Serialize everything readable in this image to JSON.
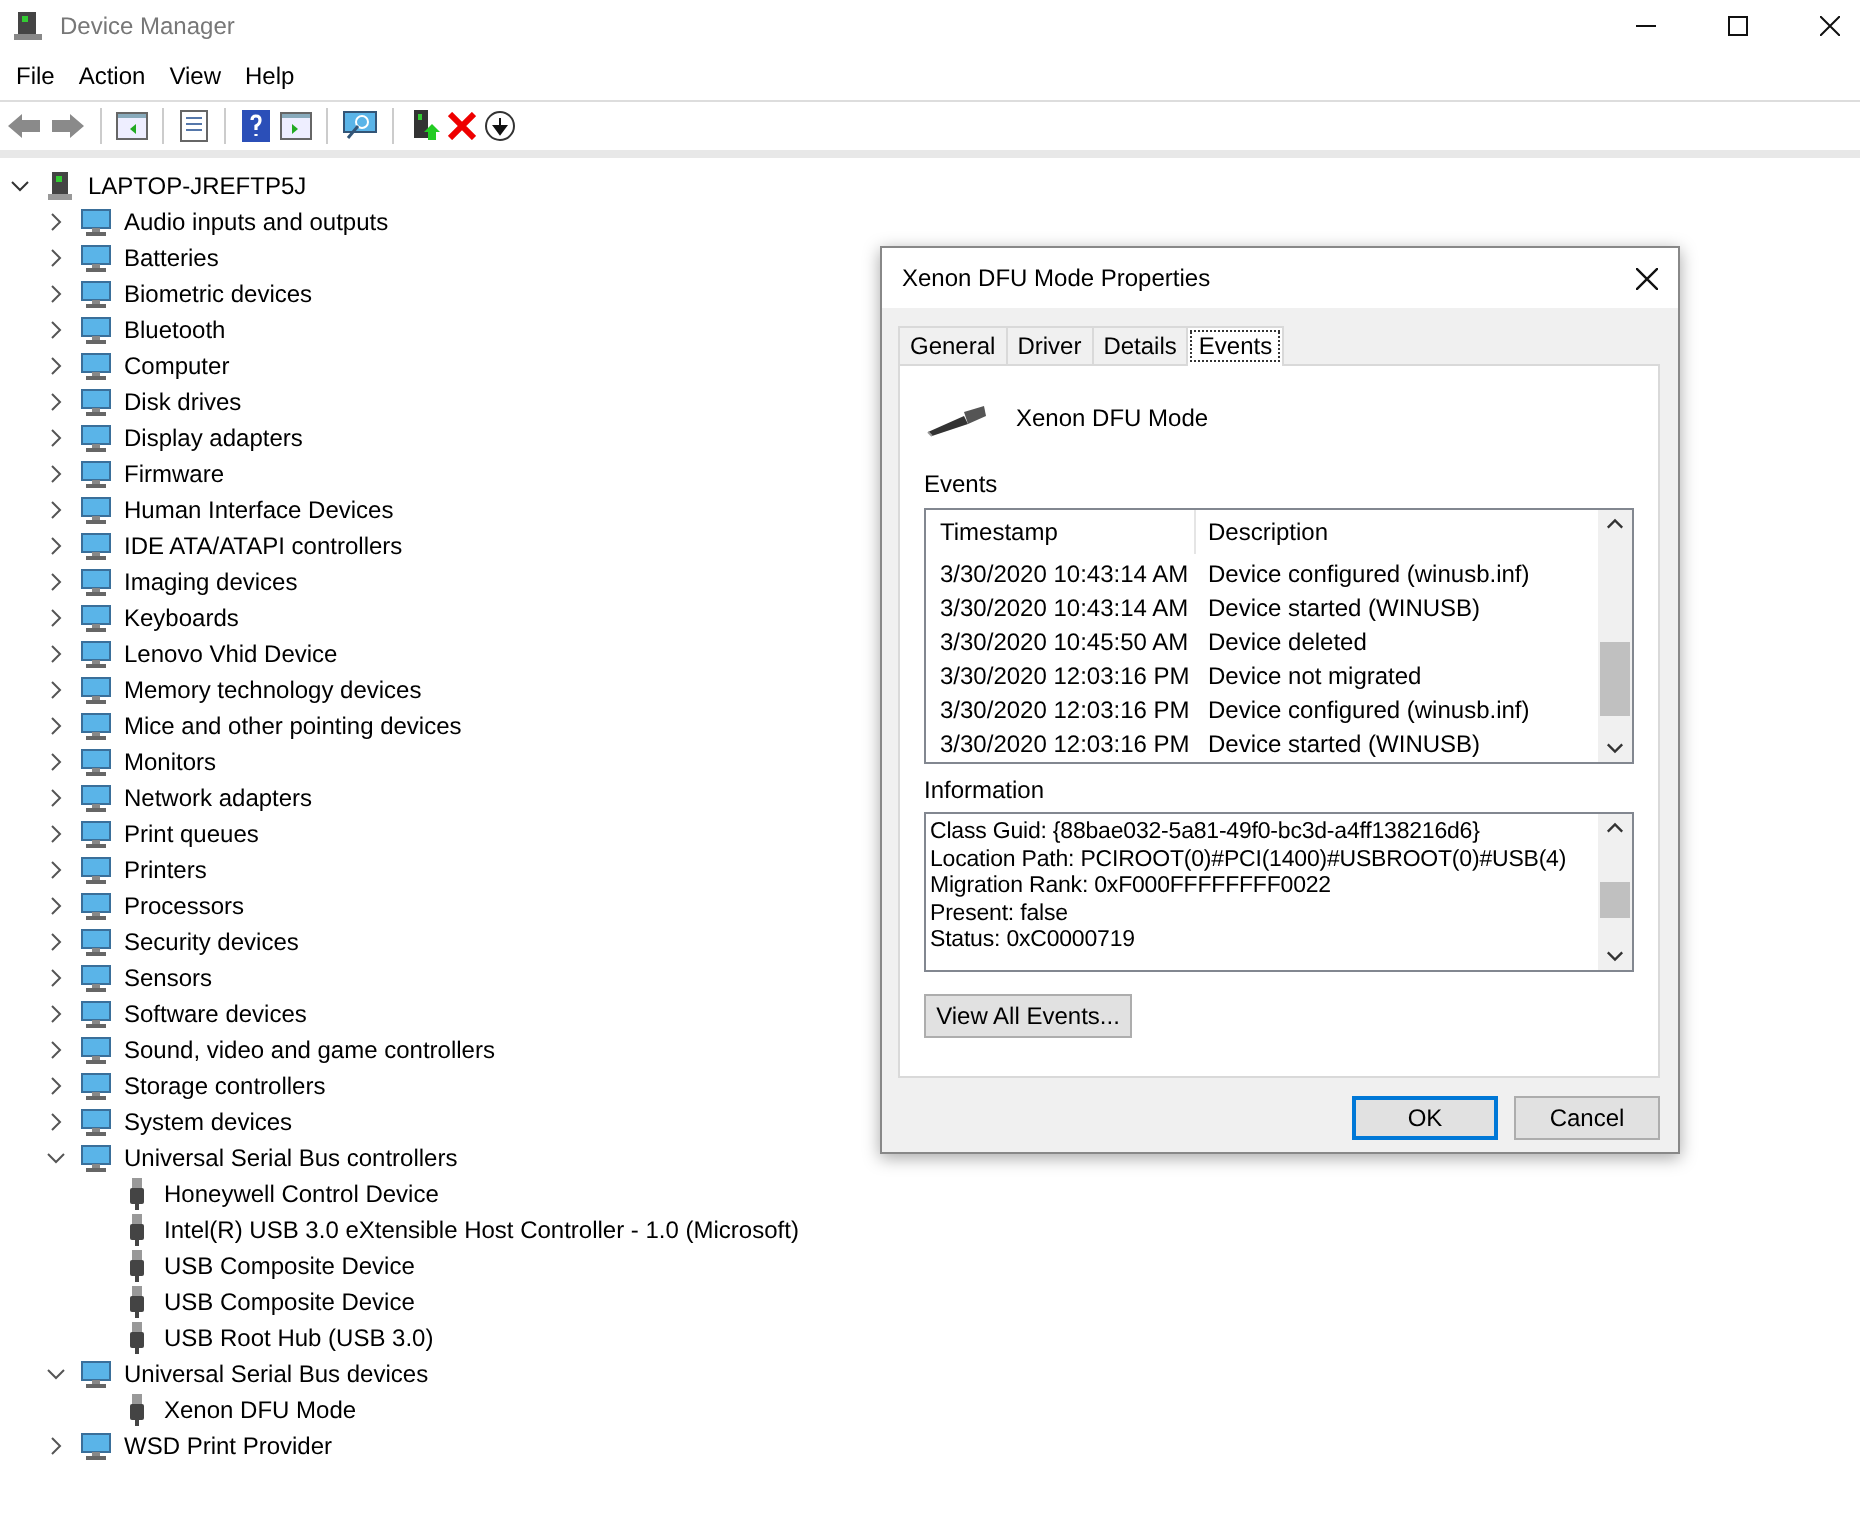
{
  "window": {
    "title": "Device Manager"
  },
  "menu": [
    "File",
    "Action",
    "View",
    "Help"
  ],
  "tree": {
    "label": "LAPTOP-JREFTP5J",
    "expanded": true,
    "children": [
      {
        "label": "Audio inputs and outputs",
        "expanded": false
      },
      {
        "label": "Batteries",
        "expanded": false
      },
      {
        "label": "Biometric devices",
        "expanded": false
      },
      {
        "label": "Bluetooth",
        "expanded": false
      },
      {
        "label": "Computer",
        "expanded": false
      },
      {
        "label": "Disk drives",
        "expanded": false
      },
      {
        "label": "Display adapters",
        "expanded": false
      },
      {
        "label": "Firmware",
        "expanded": false
      },
      {
        "label": "Human Interface Devices",
        "expanded": false
      },
      {
        "label": "IDE ATA/ATAPI controllers",
        "expanded": false
      },
      {
        "label": "Imaging devices",
        "expanded": false
      },
      {
        "label": "Keyboards",
        "expanded": false
      },
      {
        "label": "Lenovo Vhid Device",
        "expanded": false
      },
      {
        "label": "Memory technology devices",
        "expanded": false
      },
      {
        "label": "Mice and other pointing devices",
        "expanded": false
      },
      {
        "label": "Monitors",
        "expanded": false
      },
      {
        "label": "Network adapters",
        "expanded": false
      },
      {
        "label": "Print queues",
        "expanded": false
      },
      {
        "label": "Printers",
        "expanded": false
      },
      {
        "label": "Processors",
        "expanded": false
      },
      {
        "label": "Security devices",
        "expanded": false
      },
      {
        "label": "Sensors",
        "expanded": false
      },
      {
        "label": "Software devices",
        "expanded": false
      },
      {
        "label": "Sound, video and game controllers",
        "expanded": false
      },
      {
        "label": "Storage controllers",
        "expanded": false
      },
      {
        "label": "System devices",
        "expanded": false
      },
      {
        "label": "Universal Serial Bus controllers",
        "expanded": true,
        "children": [
          {
            "label": "Honeywell Control Device"
          },
          {
            "label": "Intel(R) USB 3.0 eXtensible Host Controller - 1.0 (Microsoft)"
          },
          {
            "label": "USB Composite Device"
          },
          {
            "label": "USB Composite Device"
          },
          {
            "label": "USB Root Hub (USB 3.0)"
          }
        ]
      },
      {
        "label": "Universal Serial Bus devices",
        "expanded": true,
        "children": [
          {
            "label": "Xenon DFU Mode"
          }
        ]
      },
      {
        "label": "WSD Print Provider",
        "expanded": false
      }
    ]
  },
  "dialog": {
    "title": "Xenon DFU Mode Properties",
    "tabs": [
      {
        "label": "General",
        "selected": false
      },
      {
        "label": "Driver",
        "selected": false
      },
      {
        "label": "Details",
        "selected": false
      },
      {
        "label": "Events",
        "selected": true
      }
    ],
    "device_name": "Xenon DFU Mode",
    "events_label": "Events",
    "events_columns": [
      "Timestamp",
      "Description"
    ],
    "events_rows": [
      [
        "3/30/2020 10:43:14 AM",
        "Device configured (winusb.inf)"
      ],
      [
        "3/30/2020 10:43:14 AM",
        "Device started (WINUSB)"
      ],
      [
        "3/30/2020 10:45:50 AM",
        "Device deleted"
      ],
      [
        "3/30/2020 12:03:16 PM",
        "Device not migrated"
      ],
      [
        "3/30/2020 12:03:16 PM",
        "Device configured (winusb.inf)"
      ],
      [
        "3/30/2020 12:03:16 PM",
        "Device started (WINUSB)"
      ]
    ],
    "information_label": "Information",
    "information_lines": [
      "Class Guid: {88bae032-5a81-49f0-bc3d-a4ff138216d6}",
      "Location Path: PCIROOT(0)#PCI(1400)#USBROOT(0)#USB(4)",
      "Migration Rank: 0xF000FFFFFFFF0022",
      "Present: false",
      "Status: 0xC0000719"
    ],
    "view_all_button": "View All Events...",
    "buttons": [
      "OK",
      "Cancel"
    ]
  }
}
